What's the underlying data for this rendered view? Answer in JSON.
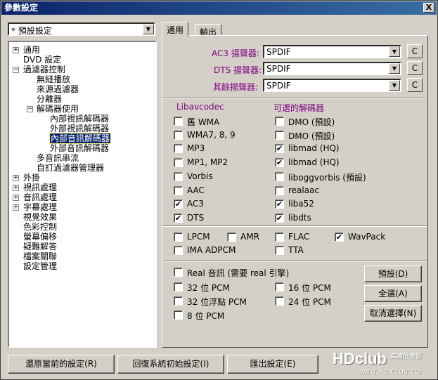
{
  "window": {
    "title": "參數設定",
    "close": "X"
  },
  "preset": {
    "value": "* 預設設定"
  },
  "tree": [
    {
      "label": "通用",
      "exp": "+"
    },
    {
      "label": "DVD 設定",
      "exp": ""
    },
    {
      "label": "過濾器控制",
      "exp": "-"
    },
    {
      "label": "無縫播放",
      "exp": ""
    },
    {
      "label": "來源過濾器",
      "exp": ""
    },
    {
      "label": "分離器",
      "exp": ""
    },
    {
      "label": "解碼器使用",
      "exp": "-"
    },
    {
      "label": "內部視訊解碼器",
      "exp": ""
    },
    {
      "label": "外部視訊解碼器",
      "exp": ""
    },
    {
      "label": "內部音訊解碼器",
      "exp": ""
    },
    {
      "label": "外部音訊解碼器",
      "exp": ""
    },
    {
      "label": "多音訊串流",
      "exp": ""
    },
    {
      "label": "自訂過濾器管理器",
      "exp": ""
    },
    {
      "label": "外掛",
      "exp": "+"
    },
    {
      "label": "視訊處理",
      "exp": "+"
    },
    {
      "label": "音訊處理",
      "exp": "+"
    },
    {
      "label": "字幕處理",
      "exp": "+"
    },
    {
      "label": "視覺效果",
      "exp": ""
    },
    {
      "label": "色彩控制",
      "exp": ""
    },
    {
      "label": "螢幕偏移",
      "exp": ""
    },
    {
      "label": "疑難解答",
      "exp": ""
    },
    {
      "label": "檔案關聯",
      "exp": ""
    },
    {
      "label": "設定管理",
      "exp": ""
    }
  ],
  "tabs": {
    "general": "通用",
    "output": "輸出"
  },
  "renderers": {
    "ac3_label": "AC3 揚聲器:",
    "ac3_value": "SPDIF",
    "dts_label": "DTS 揚聲器:",
    "dts_value": "SPDIF",
    "other_label": "其餘揚聲器:",
    "other_value": "SPDIF",
    "c": "C"
  },
  "decoders": {
    "lib_header": "Libavcodec",
    "alt_header": "可選的解碼器",
    "left": [
      {
        "label": "舊 WMA",
        "checked": false
      },
      {
        "label": "WMA7, 8, 9",
        "checked": false
      },
      {
        "label": "MP3",
        "checked": false
      },
      {
        "label": "MP1, MP2",
        "checked": false
      },
      {
        "label": "Vorbis",
        "checked": false
      },
      {
        "label": "AAC",
        "checked": false
      },
      {
        "label": "AC3",
        "checked": true
      },
      {
        "label": "DTS",
        "checked": true
      }
    ],
    "right": [
      {
        "label": "DMO (預設)",
        "checked": false
      },
      {
        "label": "DMO (預設)",
        "checked": false
      },
      {
        "label": "libmad (HQ)",
        "checked": true
      },
      {
        "label": "libmad (HQ)",
        "checked": true
      },
      {
        "label": "liboggvorbis (預設)",
        "checked": false
      },
      {
        "label": "realaac",
        "checked": false
      },
      {
        "label": "liba52",
        "checked": true
      },
      {
        "label": "libdts",
        "checked": true
      }
    ]
  },
  "formats": [
    {
      "label": "LPCM",
      "checked": false
    },
    {
      "label": "AMR",
      "checked": false
    },
    {
      "label": "FLAC",
      "checked": false
    },
    {
      "label": "WavPack",
      "checked": true
    },
    {
      "label": "IMA ADPCM",
      "checked": false
    },
    {
      "label": "TTA",
      "checked": false
    }
  ],
  "pcm": [
    {
      "label": "Real 音訊 (需要 real 引擎)",
      "checked": false
    },
    {
      "label": "32 位 PCM",
      "checked": false
    },
    {
      "label": "16 位 PCM",
      "checked": false
    },
    {
      "label": "32 位浮點 PCM",
      "checked": false
    },
    {
      "label": "24 位 PCM",
      "checked": false
    },
    {
      "label": "8 位 PCM",
      "checked": false
    }
  ],
  "side_buttons": {
    "default": "預設(D)",
    "all": "全選(A)",
    "none": "取消選擇(N)"
  },
  "bottom_buttons": {
    "restore": "還原當前的設定(R)",
    "reset": "回復系統初始設定(I)",
    "export": "匯出設定(E)"
  },
  "watermark": {
    "brand": "HDclub",
    "site": "WWW.HD.CLUB.TW",
    "cn": "高清俱樂部"
  }
}
